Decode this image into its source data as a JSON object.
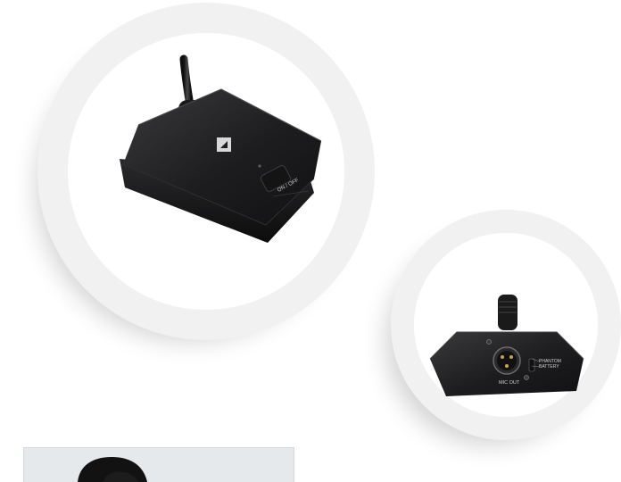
{
  "products": [
    {
      "name": "mic-top-view",
      "labels": {
        "switch": "ON / OFF"
      }
    },
    {
      "name": "mic-rear-view",
      "labels": {
        "output": "MIC OUT",
        "phantom": "PHANTOM",
        "battery": "BATTERY"
      }
    }
  ],
  "colors": {
    "background": "#ffffff",
    "ring": "#f3f3f3",
    "mic_body": "#1e1e20",
    "label_text": "#cfcfcf"
  }
}
